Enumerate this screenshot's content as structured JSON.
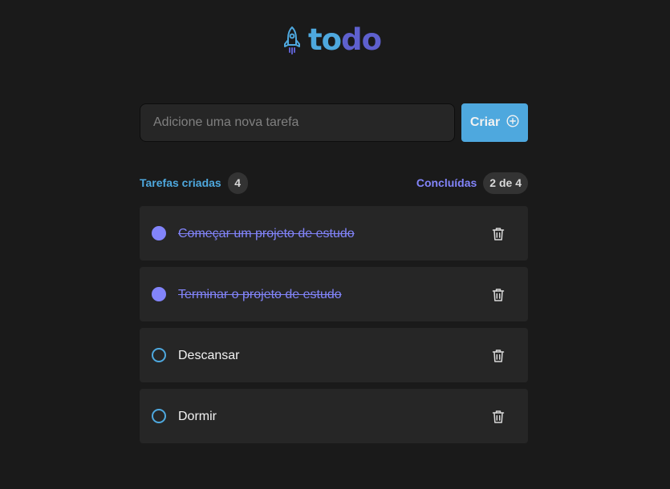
{
  "header": {
    "logo_part1": "to",
    "logo_part2": "do",
    "icon": "rocket-icon"
  },
  "create": {
    "placeholder": "Adicione uma nova tarefa",
    "value": "",
    "button_label": "Criar",
    "button_icon": "plus-circle-icon"
  },
  "counters": {
    "created_label": "Tarefas criadas",
    "created_count": "4",
    "done_label": "Concluídas",
    "done_count": "2 de 4"
  },
  "tasks": [
    {
      "text": "Começar um projeto de estudo",
      "done": true
    },
    {
      "text": "Terminar o projeto de estudo",
      "done": true
    },
    {
      "text": "Descansar",
      "done": false
    },
    {
      "text": "Dormir",
      "done": false
    }
  ],
  "colors": {
    "background": "#1a1a1a",
    "surface": "#262626",
    "blue": "#4ea8de",
    "purple": "#8284fa",
    "purple_dark": "#5e60ce",
    "text": "#f2f2f2",
    "muted": "#808080"
  }
}
